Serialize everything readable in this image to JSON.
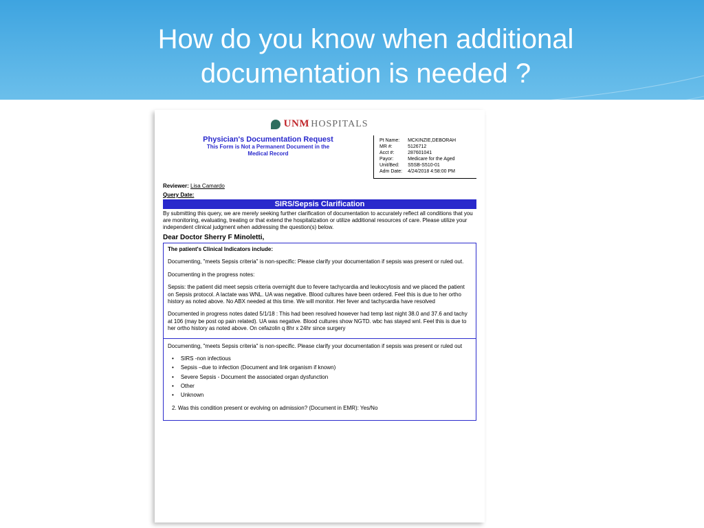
{
  "slide": {
    "title": "How do you know when additional documentation is needed ?"
  },
  "logo": {
    "unm": "UNM",
    "hospitals": "HOSPITALS"
  },
  "header": {
    "title": "Physician's Documentation Request",
    "subtitle1": "This Form is Not a Permanent Document in the",
    "subtitle2": "Medical Record"
  },
  "patient": {
    "labels": {
      "name": "Pt Name:",
      "mr": "MR #:",
      "acct": "Acct #:",
      "payor": "Payor:",
      "unitbed": "Unit/Bed:",
      "admdate": "Adm Date:"
    },
    "values": {
      "name": "MCKINZIE,DEBORAH",
      "mr": "5126712",
      "acct": "287601041",
      "payor": "Medicare for the Aged",
      "unitbed": "S5SB-S510-01",
      "admdate": "4/24/2018 4:58:00 PM"
    }
  },
  "reviewer": {
    "label": "Reviewer:",
    "name": "Lisa Camardo"
  },
  "query_date_label": "Query Date:",
  "bar_title": "SIRS/Sepsis Clarification",
  "intro": "By submitting this query, we are merely seeking further clarification of documentation to accurately reflect all conditions that you are monitoring, evaluating, treating or that extend the hospitalization or utilize additional resources of care. Please utilize your independent clinical judgment when addressing the question(s) below.",
  "dear": "Dear Doctor  Sherry  F Minoletti,",
  "section1": {
    "heading": "The patient's Clinical Indicators include:",
    "p1": " Documenting, \"meets Sepsis criteria\" is non-specific: Please clarify your documentation if sepsis was present or ruled out.",
    "p2": "Documenting in the progress notes:",
    "p3": "Sepsis: the patient did meet sepsis criteria overnight due to fevere tachycardia and leukocytosis and we placed the patient on Sepsis protocol. A lactate was WNL. UA was negative. Blood cultures have been ordered. Feel this is due to her ortho history as noted above. No ABX needed at this time. We will monitor. Her fever and tachycardia have resolved",
    "p4": "Documented in progress notes dated 5/1/18 : This had been resolved however had temp last night 38.0 and 37.6 and tachy at 106 (may be post op pain related). UA was negative. Blood cultures show NGTD. wbc has stayed wnl. Feel this is due to her ortho history as noted above. On cefazolin q 8hr x 24hr since surgery"
  },
  "section2": {
    "p1": "Documenting, \"meets Sepsis criteria\" is non-specific. Please clarify your documentation if sepsis was present or ruled out",
    "bullets": [
      "SIRS -non infectious",
      "Sepsis –due to infection (Document and link organism if known)",
      "Severe Sepsis - Document the associated organ dysfunction",
      "Other",
      "Unknown"
    ],
    "q2": "2.       Was this condition present or evolving on admission? (Document in EMR):  Yes/No"
  }
}
